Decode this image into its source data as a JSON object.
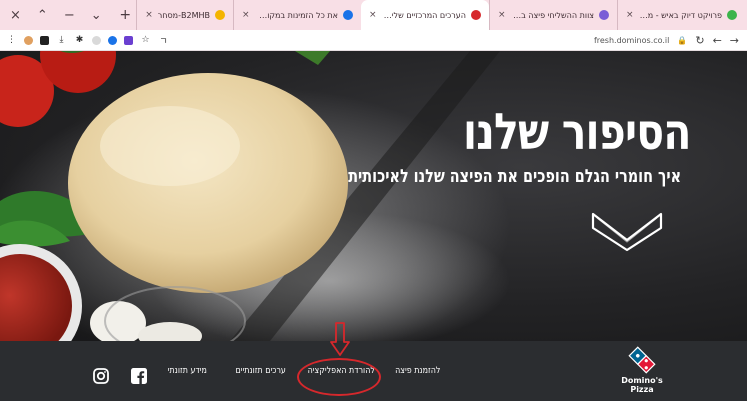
{
  "window": {
    "controls": [
      "×",
      "⌃",
      "−",
      "⌄"
    ]
  },
  "tabs": [
    {
      "title": "פרויקט דיוק באיש - משפחה באח",
      "favicon_color": "#3cb44b",
      "active": false
    },
    {
      "title": "צוות ההשליחי פיצה ברחבי הארץ",
      "favicon_color": "#7a5cd6",
      "active": false
    },
    {
      "title": "הערכים המרכזיים שלי דומינו",
      "favicon_color": "#d6282c",
      "active": true
    },
    {
      "title": "את כל הזמינות במקום את ה- ספ",
      "favicon_color": "#1a73e8",
      "active": false
    },
    {
      "title": "B2MHB-מסחר",
      "favicon_color": "#f4b400",
      "active": false
    }
  ],
  "toolbar": {
    "url": "fresh.dominos.co.il",
    "reload_icon": "↻",
    "back_icon": "←",
    "forward_icon": "→",
    "lock_icon": "🔒",
    "star_icon": "☆"
  },
  "hero": {
    "title": "הסיפור שלנו",
    "subtitle": "איך חומרי הגלם הופכים את הפיצה שלנו לאיכותית"
  },
  "footer": {
    "nav": {
      "order_pizza": "להזמנת פיצה",
      "download_app": "להורדת האפליקציה",
      "franchise_values": "ערכים תזונתיים",
      "nutrition_info": "מידע תזונתי"
    },
    "logo_text_1": "Domino's",
    "logo_text_2": "Pizza"
  },
  "colors": {
    "brand_blue": "#006491",
    "brand_red": "#e31837",
    "annotation_red": "#d6282c",
    "footer_bg": "#2b2d30"
  }
}
